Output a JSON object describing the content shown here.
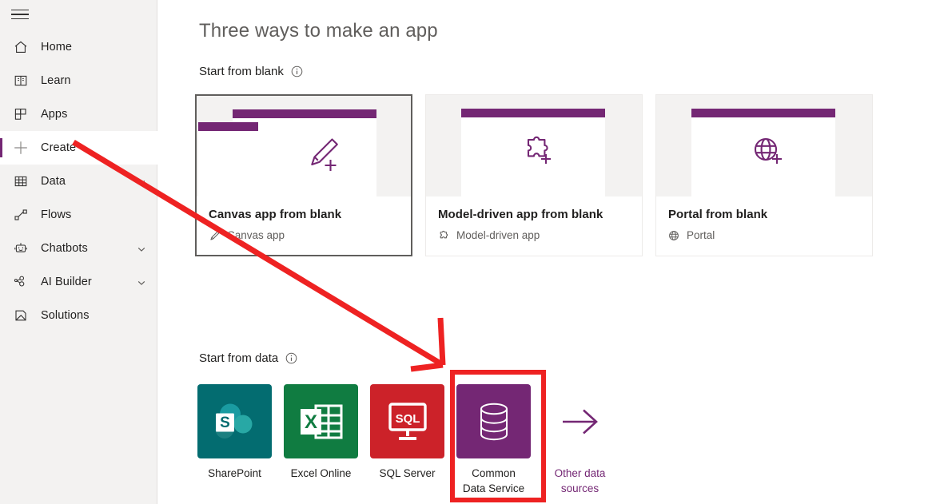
{
  "app": {
    "accent_purple": "#742774",
    "sidebar_bg": "#f3f2f1",
    "annotation_red": "#ee2222"
  },
  "sidebar": {
    "menu_button_name": "hamburger-menu",
    "items": [
      {
        "label": "Home",
        "icon": "home-icon",
        "chevron": false,
        "selected": false
      },
      {
        "label": "Learn",
        "icon": "book-icon",
        "chevron": false,
        "selected": false
      },
      {
        "label": "Apps",
        "icon": "apps-grid-icon",
        "chevron": false,
        "selected": false
      },
      {
        "label": "Create",
        "icon": "plus-icon",
        "chevron": false,
        "selected": true
      },
      {
        "label": "Data",
        "icon": "table-icon",
        "chevron": true,
        "selected": false
      },
      {
        "label": "Flows",
        "icon": "flow-icon",
        "chevron": false,
        "selected": false
      },
      {
        "label": "Chatbots",
        "icon": "robot-icon",
        "chevron": true,
        "selected": false
      },
      {
        "label": "AI Builder",
        "icon": "ai-nodes-icon",
        "chevron": true,
        "selected": false
      },
      {
        "label": "Solutions",
        "icon": "solutions-icon",
        "chevron": false,
        "selected": false
      }
    ]
  },
  "main": {
    "page_title": "Three ways to make an app",
    "sections": {
      "blank": {
        "heading": "Start from blank",
        "info_tooltip": "info-icon"
      },
      "data": {
        "heading": "Start from data",
        "info_tooltip": "info-icon"
      }
    },
    "cards": [
      {
        "title": "Canvas app from blank",
        "subtitle": "Canvas app",
        "sub_icon": "paintbrush-icon",
        "visual": "canvas-windows",
        "glyph": "brush-plus-icon",
        "active": true
      },
      {
        "title": "Model-driven app from blank",
        "subtitle": "Model-driven app",
        "sub_icon": "puzzle-icon",
        "visual": "single-window",
        "glyph": "puzzle-plus-icon",
        "active": false
      },
      {
        "title": "Portal from blank",
        "subtitle": "Portal",
        "sub_icon": "globe-icon",
        "visual": "single-window",
        "glyph": "globe-plus-icon",
        "active": false
      }
    ],
    "tiles": [
      {
        "label": "SharePoint",
        "icon": "sharepoint-icon",
        "bg": "#036c70",
        "kind": "brand"
      },
      {
        "label": "Excel Online",
        "icon": "excel-icon",
        "bg": "#107c41",
        "kind": "brand"
      },
      {
        "label": "SQL Server",
        "icon": "sql-server-icon",
        "bg": "#cc2229",
        "kind": "brand"
      },
      {
        "label": "Common\nData Service",
        "icon": "database-icon",
        "bg": "#742774",
        "kind": "brand"
      },
      {
        "label": "Other data\nsources",
        "icon": "arrow-right-icon",
        "bg": "#ffffff",
        "kind": "link"
      }
    ]
  },
  "annotations": {
    "arrow": {
      "name": "red-arrow-annotation",
      "from": "Create sidebar item",
      "to": "Common Data Service tile"
    },
    "highlight_box": {
      "name": "red-highlight-box",
      "target": "Common Data Service tile"
    }
  }
}
